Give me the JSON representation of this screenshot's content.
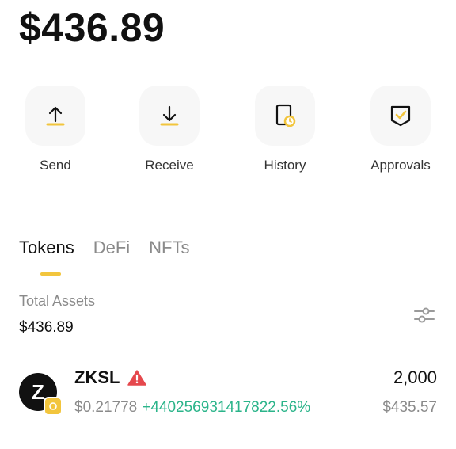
{
  "balance": "$436.89",
  "actions": [
    {
      "label": "Send",
      "icon": "arrow-up-icon"
    },
    {
      "label": "Receive",
      "icon": "arrow-down-icon"
    },
    {
      "label": "History",
      "icon": "history-icon"
    },
    {
      "label": "Approvals",
      "icon": "approvals-icon"
    }
  ],
  "tabs": [
    {
      "label": "Tokens",
      "active": true
    },
    {
      "label": "DeFi",
      "active": false
    },
    {
      "label": "NFTs",
      "active": false
    }
  ],
  "total": {
    "label": "Total Assets",
    "value": "$436.89"
  },
  "tokens": [
    {
      "avatar_letter": "Z",
      "name": "ZKSL",
      "warning_icon": "warning-icon",
      "price": "$0.21778",
      "change": "+440256931417822.56%",
      "amount": "2,000",
      "value": "$435.57"
    }
  ],
  "colors": {
    "accent": "#f2c53d",
    "positive": "#2bb48a",
    "warning": "#e5484d",
    "muted": "#8a8a8a"
  }
}
